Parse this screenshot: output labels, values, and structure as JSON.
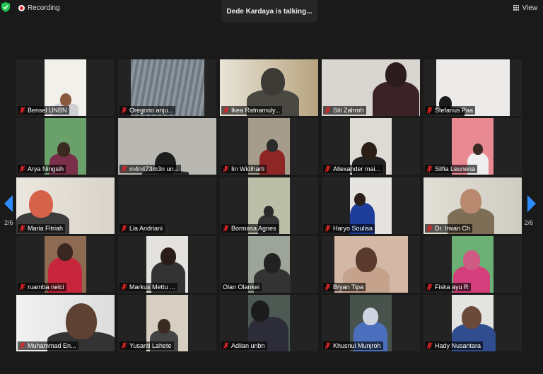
{
  "topbar": {
    "recording_label": "Recording",
    "speaker_text": "Dede Kardaya is talking...",
    "view_label": "View"
  },
  "pagination": {
    "left_page": "2/6",
    "right_page": "2/6"
  },
  "participants": [
    {
      "name": "Bensel UNBN",
      "muted": true
    },
    {
      "name": "Oregono anju...",
      "muted": true
    },
    {
      "name": "Ikea Ratnamuly...",
      "muted": true
    },
    {
      "name": "Siti Zahroh",
      "muted": true
    },
    {
      "name": "Stefanus Paa",
      "muted": true
    },
    {
      "name": "Arya Ningsih",
      "muted": true
    },
    {
      "name": "m4n473m3n un...",
      "muted": true
    },
    {
      "name": "Iin Widiharti",
      "muted": true
    },
    {
      "name": "Allexander mai...",
      "muted": true
    },
    {
      "name": "Silfia Leunena",
      "muted": true
    },
    {
      "name": "Maria Fitriah",
      "muted": true
    },
    {
      "name": "Lia Andriani",
      "muted": true
    },
    {
      "name": "Bormasa Agnes",
      "muted": true
    },
    {
      "name": "Haryo Soulisa",
      "muted": true
    },
    {
      "name": "Dr. Irwan Ch",
      "muted": true
    },
    {
      "name": "ruamba nelci",
      "muted": true
    },
    {
      "name": "Markus Mettu ...",
      "muted": true
    },
    {
      "name": "Olan Olankei",
      "muted": false
    },
    {
      "name": "Bryan Tipa",
      "muted": true
    },
    {
      "name": "Fiska ayu R",
      "muted": true
    },
    {
      "name": "Muhammad En...",
      "muted": true
    },
    {
      "name": "Yusanti Lahete",
      "muted": true
    },
    {
      "name": "Adlian unbn",
      "muted": true
    },
    {
      "name": "Khusnul Munjroh",
      "muted": true
    },
    {
      "name": "Hady Nusantara",
      "muted": true
    }
  ],
  "colors": {
    "background": "#1a1a1a",
    "tile": "#232323",
    "accent_blue": "#2d8cff",
    "mute_red": "#e02424",
    "shield_green": "#23c552"
  }
}
